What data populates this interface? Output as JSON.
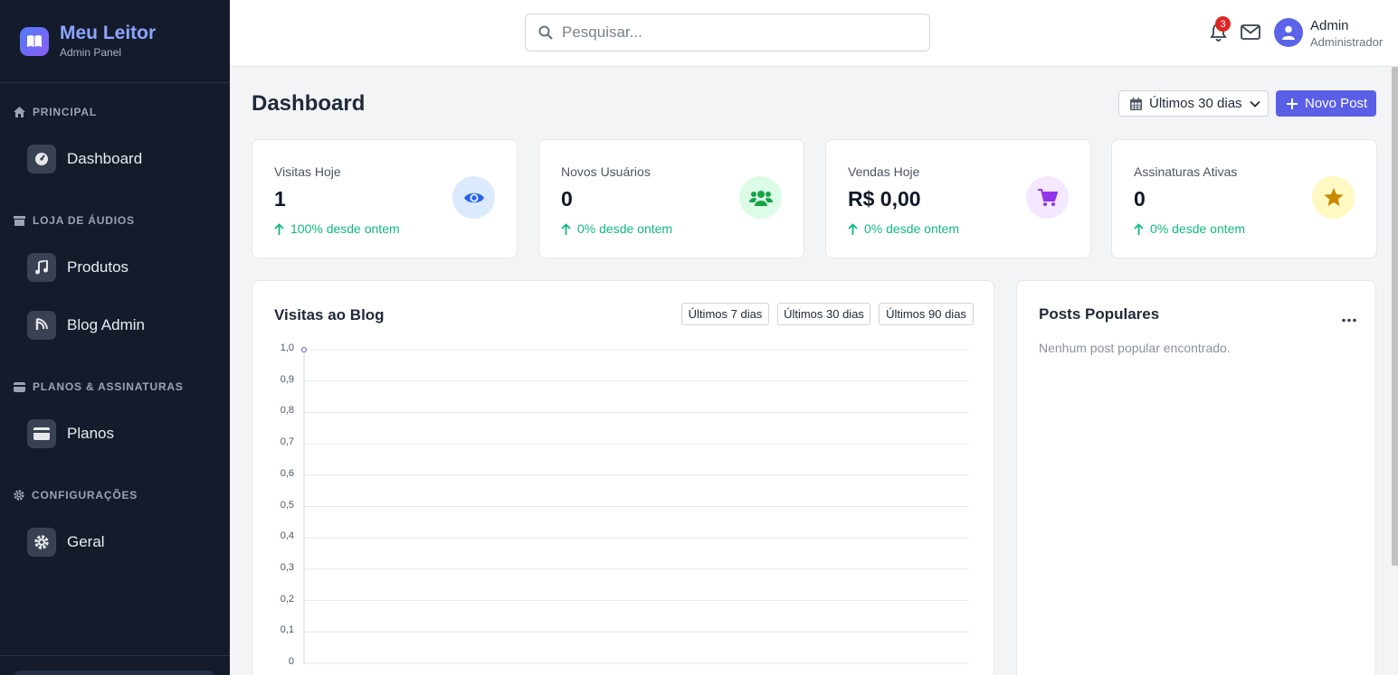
{
  "brand": {
    "title": "Meu Leitor",
    "subtitle": "Admin Panel"
  },
  "sidebar": {
    "sections": [
      {
        "label": "PRINCIPAL",
        "icon": "home-icon"
      },
      {
        "label": "LOJA DE ÁUDIOS",
        "icon": "store-icon"
      },
      {
        "label": "PLANOS & ASSINATURAS",
        "icon": "card-icon"
      },
      {
        "label": "CONFIGURAÇÕES",
        "icon": "gear-icon"
      }
    ],
    "items": [
      {
        "label": "Dashboard",
        "icon": "gauge-icon"
      },
      {
        "label": "Produtos",
        "icon": "music-icon"
      },
      {
        "label": "Blog Admin",
        "icon": "blog-icon"
      },
      {
        "label": "Planos",
        "icon": "credit-card-icon"
      },
      {
        "label": "Geral",
        "icon": "gear-icon"
      }
    ]
  },
  "topbar": {
    "search_placeholder": "Pesquisar...",
    "notifications_count": "3",
    "user": {
      "name": "Admin",
      "role": "Administrador"
    }
  },
  "main": {
    "title": "Dashboard",
    "date_range": "Últimos 30 dias",
    "new_post": "Novo Post",
    "cards": [
      {
        "label": "Visitas Hoje",
        "value": "1",
        "change": "100% desde ontem",
        "icon": "eye-icon",
        "color": "#2563eb",
        "bg": "#dbeafe"
      },
      {
        "label": "Novos Usuários",
        "value": "0",
        "change": "0% desde ontem",
        "icon": "users-icon",
        "color": "#16a34a",
        "bg": "#dcfce7"
      },
      {
        "label": "Vendas Hoje",
        "value": "R$ 0,00",
        "change": "0% desde ontem",
        "icon": "cart-icon",
        "color": "#9333ea",
        "bg": "#f3e8ff"
      },
      {
        "label": "Assinaturas Ativas",
        "value": "0",
        "change": "0% desde ontem",
        "icon": "star-icon",
        "color": "#ca8a04",
        "bg": "#fef9c3"
      }
    ],
    "blog_panel": {
      "title": "Visitas ao Blog",
      "ranges": [
        "Últimos 7 dias",
        "Últimos 30 dias",
        "Últimos 90 dias"
      ]
    },
    "popular_panel": {
      "title": "Posts Populares",
      "empty_message": "Nenhum post popular encontrado."
    }
  },
  "colors": {
    "accent": "#5b5fe6",
    "sidebar_bg": "#141c2c",
    "positive": "#10b981"
  },
  "chart_data": {
    "type": "line",
    "title": "Visitas ao Blog",
    "yticks": [
      "1,0",
      "0,9",
      "0,8",
      "0,7",
      "0,6",
      "0,5",
      "0,4",
      "0,3",
      "0,2",
      "0,1",
      "0"
    ],
    "ylim": [
      0,
      1
    ],
    "grid": true,
    "series": [
      {
        "values": [
          1
        ]
      }
    ]
  }
}
